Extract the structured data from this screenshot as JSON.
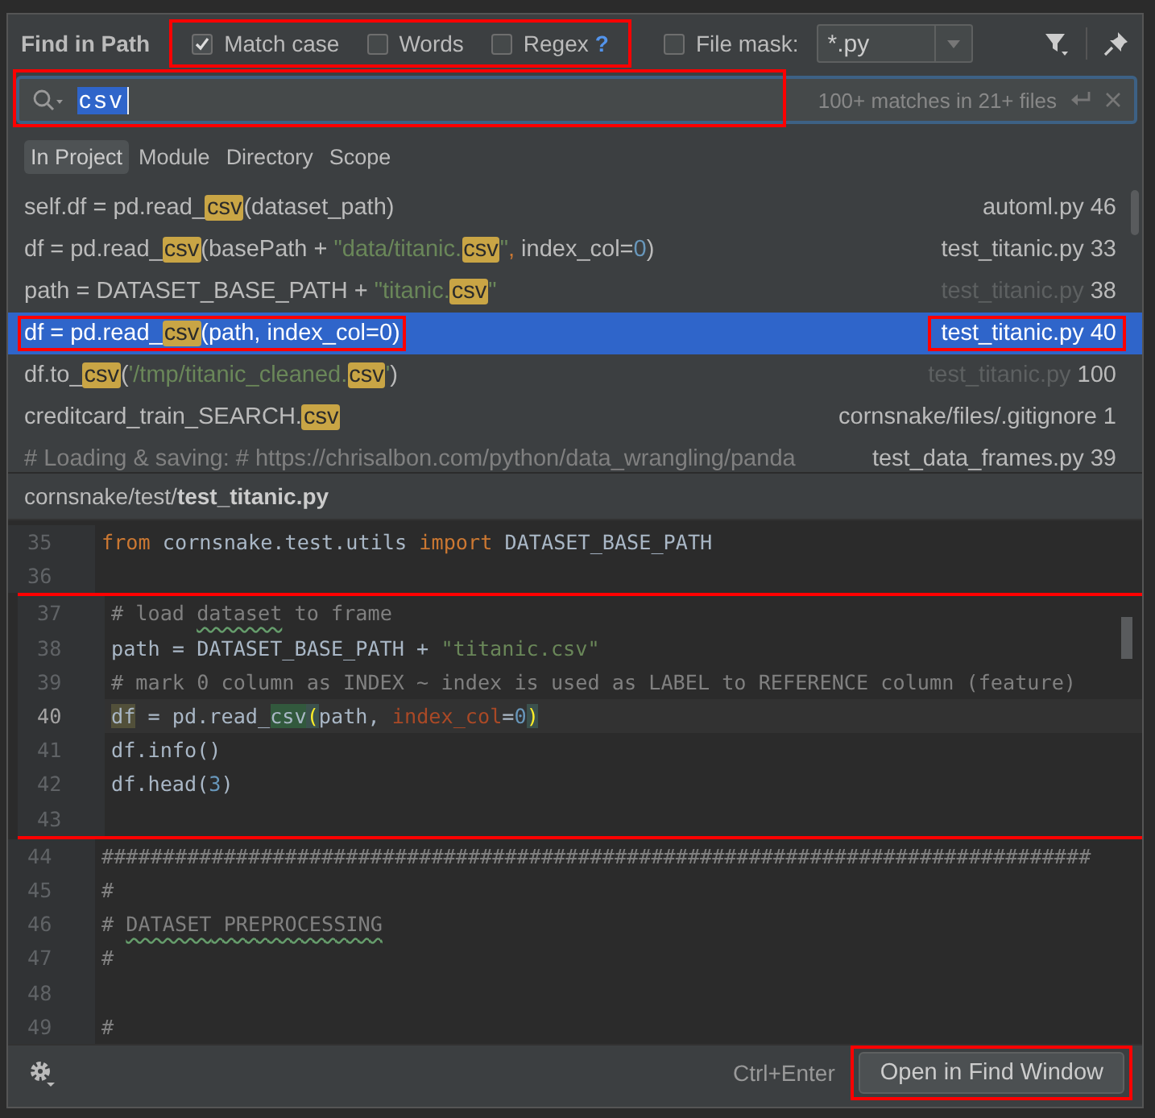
{
  "title": "Find in Path",
  "options": {
    "annotated": true,
    "items": [
      {
        "kind": "checkbox",
        "label": "Match case",
        "checked": true
      },
      {
        "kind": "checkbox",
        "label": "Words",
        "checked": false
      },
      {
        "kind": "checkbox",
        "label": "Regex",
        "checked": false,
        "help": "?"
      }
    ]
  },
  "file_mask": {
    "label": "File mask:",
    "checked": false,
    "value": "*.py"
  },
  "search": {
    "value": "csv",
    "status": "100+ matches in 21+ files",
    "annotated": true
  },
  "scopes": [
    {
      "label": "In Project",
      "selected": true
    },
    {
      "label": "Module",
      "selected": false
    },
    {
      "label": "Directory",
      "selected": false
    },
    {
      "label": "Scope",
      "selected": false
    }
  ],
  "results": [
    {
      "segments": [
        {
          "kind": "plain",
          "text": "self.df = pd.read_"
        },
        {
          "kind": "match",
          "text": "csv"
        },
        {
          "kind": "plain",
          "text": "(dataset_path)"
        }
      ],
      "file": "automl.py",
      "line": "46",
      "file_dim": false,
      "selected": false,
      "annotated": false
    },
    {
      "segments": [
        {
          "kind": "plain",
          "text": "df = pd.read_"
        },
        {
          "kind": "match",
          "text": "csv"
        },
        {
          "kind": "plain",
          "text": "(basePath + "
        },
        {
          "kind": "string",
          "text": "\"data/titanic."
        },
        {
          "kind": "match",
          "text": "csv"
        },
        {
          "kind": "string",
          "text": "\""
        },
        {
          "kind": "punct",
          "text": ","
        },
        {
          "kind": "plain",
          "text": " index_col="
        },
        {
          "kind": "number",
          "text": "0"
        },
        {
          "kind": "plain",
          "text": ")"
        }
      ],
      "file": "test_titanic.py",
      "line": "33",
      "file_dim": false,
      "selected": false,
      "annotated": false
    },
    {
      "segments": [
        {
          "kind": "plain",
          "text": "path = DATASET_BASE_PATH + "
        },
        {
          "kind": "string",
          "text": "\"titanic."
        },
        {
          "kind": "match",
          "text": "csv"
        },
        {
          "kind": "string",
          "text": "\""
        }
      ],
      "file": "test_titanic.py",
      "line": "38",
      "file_dim": true,
      "selected": false,
      "annotated": false
    },
    {
      "segments": [
        {
          "kind": "plain",
          "text": "df = pd.read_"
        },
        {
          "kind": "match",
          "text": "csv"
        },
        {
          "kind": "plain",
          "text": "(path, index_col=0)"
        }
      ],
      "file": "test_titanic.py",
      "line": "40",
      "file_dim": false,
      "selected": true,
      "annotated": true
    },
    {
      "segments": [
        {
          "kind": "plain",
          "text": "df.to_"
        },
        {
          "kind": "match",
          "text": "csv"
        },
        {
          "kind": "plain",
          "text": "("
        },
        {
          "kind": "string",
          "text": "'/tmp/titanic_cleaned."
        },
        {
          "kind": "match",
          "text": "csv"
        },
        {
          "kind": "string",
          "text": "'"
        },
        {
          "kind": "plain",
          "text": ")"
        }
      ],
      "file": "test_titanic.py",
      "line": "100",
      "file_dim": true,
      "selected": false,
      "annotated": false
    },
    {
      "segments": [
        {
          "kind": "plain",
          "text": "creditcard_train_SEARCH."
        },
        {
          "kind": "match",
          "text": "csv"
        }
      ],
      "file": "cornsnake/files/.gitignore",
      "line": "1",
      "file_dim": false,
      "selected": false,
      "annotated": false
    },
    {
      "segments": [
        {
          "kind": "comment",
          "text": "# Loading & saving: # https://chrisalbon.com/python/data_wrangling/panda"
        }
      ],
      "file": "test_data_frames.py",
      "line": "39",
      "file_dim": false,
      "selected": false,
      "annotated": false
    }
  ],
  "preview": {
    "path_dir": "cornsnake/test/",
    "path_file": "test_titanic.py",
    "lines": [
      {
        "number": "35",
        "current": false,
        "annotated": false,
        "tokens": [
          {
            "kind": "kw",
            "text": "from"
          },
          {
            "kind": "plain",
            "text": " cornsnake.test.utils "
          },
          {
            "kind": "kw",
            "text": "import"
          },
          {
            "kind": "plain",
            "text": " DATASET_BASE_PATH"
          }
        ]
      },
      {
        "number": "36",
        "current": false,
        "annotated": false
      },
      {
        "number": "37",
        "current": false,
        "annotated": true,
        "tokens": [
          {
            "kind": "comment",
            "text": "# load "
          },
          {
            "kind": "typo",
            "text": "dataset"
          },
          {
            "kind": "comment",
            "text": " to frame"
          }
        ]
      },
      {
        "number": "38",
        "current": false,
        "annotated": true,
        "tokens": [
          {
            "kind": "plain",
            "text": "path = DATASET_BASE_PATH + "
          },
          {
            "kind": "string",
            "text": "\"titanic.csv\""
          }
        ]
      },
      {
        "number": "39",
        "current": false,
        "annotated": true,
        "tokens": [
          {
            "kind": "comment",
            "text": "# mark 0 column as INDEX ~ index is used as LABEL to REFERENCE column (feature)"
          }
        ]
      },
      {
        "number": "40",
        "current": true,
        "annotated": true,
        "tokens": [
          {
            "kind": "usage",
            "text": "df"
          },
          {
            "kind": "plain",
            "text": " = pd.read_"
          },
          {
            "kind": "match",
            "text": "csv"
          },
          {
            "kind": "brace",
            "text": "("
          },
          {
            "kind": "plain",
            "text": "path, "
          },
          {
            "kind": "param",
            "text": "index_col"
          },
          {
            "kind": "plain",
            "text": "="
          },
          {
            "kind": "number",
            "text": "0"
          },
          {
            "kind": "brace",
            "text": ")"
          }
        ]
      },
      {
        "number": "41",
        "current": false,
        "annotated": true,
        "tokens": [
          {
            "kind": "plain",
            "text": "df.info()"
          }
        ]
      },
      {
        "number": "42",
        "current": false,
        "annotated": true,
        "tokens": [
          {
            "kind": "plain",
            "text": "df.head("
          },
          {
            "kind": "number",
            "text": "3"
          },
          {
            "kind": "plain",
            "text": ")"
          }
        ]
      },
      {
        "number": "43",
        "current": false,
        "annotated": true
      },
      {
        "number": "44",
        "current": false,
        "annotated": false,
        "tokens": [
          {
            "kind": "comment",
            "text": "#################################################################################"
          }
        ]
      },
      {
        "number": "45",
        "current": false,
        "annotated": false,
        "tokens": [
          {
            "kind": "comment",
            "text": "#"
          }
        ]
      },
      {
        "number": "46",
        "current": false,
        "annotated": false,
        "tokens": [
          {
            "kind": "comment",
            "text": "# "
          },
          {
            "kind": "typo",
            "text": "DATASET"
          },
          {
            "kind": "typo",
            "text": " PREPROCESSING"
          }
        ]
      },
      {
        "number": "47",
        "current": false,
        "annotated": false,
        "tokens": [
          {
            "kind": "comment",
            "text": "#"
          }
        ]
      },
      {
        "number": "48",
        "current": false,
        "annotated": false
      },
      {
        "number": "49",
        "current": false,
        "annotated": false,
        "tokens": [
          {
            "kind": "comment",
            "text": "#"
          }
        ]
      }
    ]
  },
  "footer": {
    "shortcut": "Ctrl+Enter",
    "button": "Open in Find Window",
    "button_annotated": true
  }
}
